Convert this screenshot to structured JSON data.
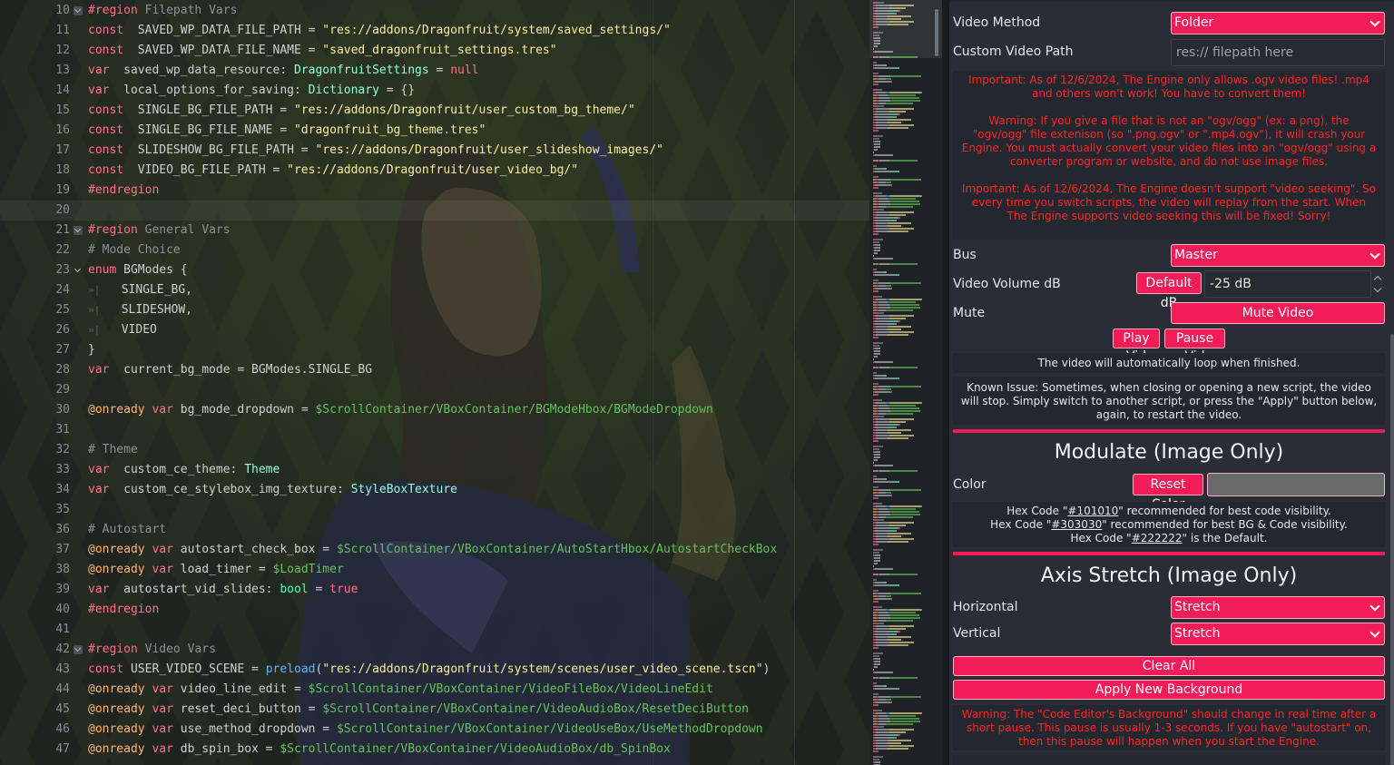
{
  "editor": {
    "lines": [
      {
        "n": "10",
        "fold": "closed",
        "spans": [
          [
            "kw",
            "#region"
          ],
          [
            "cm",
            " Filepath Vars"
          ]
        ]
      },
      {
        "n": "11",
        "spans": [
          [
            "kw",
            "const"
          ],
          [
            "",
            "  SAVED_WP_DATA_FILE_PATH = "
          ],
          [
            "str",
            "\"res://addons/Dragonfruit/system/saved_settings/\""
          ]
        ]
      },
      {
        "n": "12",
        "spans": [
          [
            "kw",
            "const"
          ],
          [
            "",
            "  SAVED_WP_DATA_FILE_NAME = "
          ],
          [
            "str",
            "\"saved_dragonfruit_settings.tres\""
          ]
        ]
      },
      {
        "n": "13",
        "spans": [
          [
            "kw",
            "var"
          ],
          [
            "",
            "  saved_wp_data_resource: "
          ],
          [
            "ty",
            "DragonfruitSettings"
          ],
          [
            "",
            " = "
          ],
          [
            "kw",
            "null"
          ]
        ]
      },
      {
        "n": "14",
        "spans": [
          [
            "kw",
            "var"
          ],
          [
            "",
            "  local_options_for_saving: "
          ],
          [
            "ty",
            "Dictionary"
          ],
          [
            "",
            " = {}"
          ]
        ]
      },
      {
        "n": "15",
        "spans": [
          [
            "kw",
            "const"
          ],
          [
            "",
            "  SINGLE_BG_FILE_PATH = "
          ],
          [
            "str",
            "\"res://addons/Dragonfruit/user_custom_bg_theme/\""
          ]
        ]
      },
      {
        "n": "16",
        "spans": [
          [
            "kw",
            "const"
          ],
          [
            "",
            "  SINGLE_BG_FILE_NAME = "
          ],
          [
            "str",
            "\"dragonfruit_bg_theme.tres\""
          ]
        ]
      },
      {
        "n": "17",
        "spans": [
          [
            "kw",
            "const"
          ],
          [
            "",
            "  SLIDESHOW_BG_FILE_PATH = "
          ],
          [
            "str",
            "\"res://addons/Dragonfruit/user_slideshow_images/\""
          ]
        ]
      },
      {
        "n": "18",
        "spans": [
          [
            "kw",
            "const"
          ],
          [
            "",
            "  VIDEO_BG_FILE_PATH = "
          ],
          [
            "str",
            "\"res://addons/Dragonfruit/user_video_bg/\""
          ]
        ]
      },
      {
        "n": "19",
        "spans": [
          [
            "kw",
            "#endregion"
          ]
        ]
      },
      {
        "n": "20",
        "hl": true,
        "spans": []
      },
      {
        "n": "21",
        "fold": "closed",
        "spans": [
          [
            "kw",
            "#region"
          ],
          [
            "cm",
            " General Vars"
          ]
        ]
      },
      {
        "n": "22",
        "spans": [
          [
            "cm",
            "# Mode Choice"
          ]
        ]
      },
      {
        "n": "23",
        "fold": "open",
        "spans": [
          [
            "kw",
            "enum"
          ],
          [
            "",
            " BGModes {"
          ]
        ]
      },
      {
        "n": "24",
        "spans": [
          [
            "tab",
            "»|"
          ],
          [
            "",
            "   SINGLE_BG,"
          ]
        ]
      },
      {
        "n": "25",
        "spans": [
          [
            "tab",
            "»|"
          ],
          [
            "",
            "   SLIDESHOW,"
          ]
        ]
      },
      {
        "n": "26",
        "spans": [
          [
            "tab",
            "»|"
          ],
          [
            "",
            "   VIDEO"
          ]
        ]
      },
      {
        "n": "27",
        "spans": [
          [
            "",
            "}"
          ]
        ]
      },
      {
        "n": "28",
        "spans": [
          [
            "kw",
            "var"
          ],
          [
            "",
            "  current_bg_mode = BGModes.SINGLE_BG"
          ]
        ]
      },
      {
        "n": "29",
        "spans": []
      },
      {
        "n": "30",
        "spans": [
          [
            "an",
            "@onready"
          ],
          [
            "",
            ""
          ],
          [
            "kw",
            " var"
          ],
          [
            "",
            " bg_mode_dropdown = "
          ],
          [
            "nd",
            "$ScrollContainer/VBoxContainer/BGModeHbox/BGModeDropdown"
          ]
        ]
      },
      {
        "n": "31",
        "spans": []
      },
      {
        "n": "32",
        "spans": [
          [
            "cm",
            "# Theme"
          ]
        ]
      },
      {
        "n": "33",
        "spans": [
          [
            "kw",
            "var"
          ],
          [
            "",
            "  custom_ce_theme: "
          ],
          [
            "ty",
            "Theme"
          ]
        ]
      },
      {
        "n": "34",
        "spans": [
          [
            "kw",
            "var"
          ],
          [
            "",
            "  custom_ce_stylebox_img_texture: "
          ],
          [
            "ty",
            "StyleBoxTexture"
          ]
        ]
      },
      {
        "n": "35",
        "spans": []
      },
      {
        "n": "36",
        "spans": [
          [
            "cm",
            "# Autostart"
          ]
        ]
      },
      {
        "n": "37",
        "spans": [
          [
            "an",
            "@onready"
          ],
          [
            "kw",
            " var"
          ],
          [
            "",
            " autostart_check_box = "
          ],
          [
            "nd",
            "$ScrollContainer/VBoxContainer/AutoStartHbox/AutostartCheckBox"
          ]
        ]
      },
      {
        "n": "38",
        "spans": [
          [
            "an",
            "@onready"
          ],
          [
            "kw",
            " var"
          ],
          [
            "",
            " load_timer = "
          ],
          [
            "nd",
            "$LoadTimer"
          ]
        ]
      },
      {
        "n": "39",
        "spans": [
          [
            "kw",
            "var"
          ],
          [
            "",
            "  autostart_vid_slides: "
          ],
          [
            "bi",
            "bool"
          ],
          [
            "",
            " = "
          ],
          [
            "kw",
            "true"
          ]
        ]
      },
      {
        "n": "40",
        "spans": [
          [
            "kw",
            "#endregion"
          ]
        ]
      },
      {
        "n": "41",
        "spans": []
      },
      {
        "n": "42",
        "fold": "closed",
        "spans": [
          [
            "kw",
            "#region"
          ],
          [
            "cm",
            " Video Vars"
          ]
        ]
      },
      {
        "n": "43",
        "spans": [
          [
            "kw",
            "const"
          ],
          [
            "",
            " USER_VIDEO_SCENE = "
          ],
          [
            "fn",
            "preload"
          ],
          [
            "",
            "("
          ],
          [
            "str",
            "\"res://addons/Dragonfruit/system/scenes/user_video_scene.tscn\""
          ],
          [
            "",
            ")"
          ]
        ]
      },
      {
        "n": "44",
        "spans": [
          [
            "an",
            "@onready"
          ],
          [
            "kw",
            " var"
          ],
          [
            "",
            " video_line_edit = "
          ],
          [
            "nd",
            "$ScrollContainer/VBoxContainer/VideoFileBox/VideoLineEdit"
          ]
        ]
      },
      {
        "n": "45",
        "spans": [
          [
            "an",
            "@onready"
          ],
          [
            "kw",
            " var"
          ],
          [
            "",
            " reset_deci_button = "
          ],
          [
            "nd",
            "$ScrollContainer/VBoxContainer/VideoAudioBox/ResetDeciButton"
          ]
        ]
      },
      {
        "n": "46",
        "spans": [
          [
            "an",
            "@onready"
          ],
          [
            "kw",
            " var"
          ],
          [
            "",
            " use_method_dropdown = "
          ],
          [
            "nd",
            "$ScrollContainer/VBoxContainer/VideoUseBox/UseMethodDropdown"
          ]
        ]
      },
      {
        "n": "47",
        "spans": [
          [
            "an",
            "@onready"
          ],
          [
            "kw",
            " var"
          ],
          [
            "",
            " db_spin_box = "
          ],
          [
            "nd",
            "$ScrollContainer/VBoxContainer/VideoAudioBox/db_SpinBox"
          ]
        ]
      }
    ]
  },
  "panel": {
    "video_method_label": "Video Method",
    "video_method_value": "Folder",
    "custom_video_path_label": "Custom Video Path",
    "custom_video_path_placeholder": "res:// filepath here",
    "important_1": "Important: As of 12/6/2024, The Engine only allows .ogv video files! .mp4 and others won't work! You have to convert them!",
    "warning_1": "Warning: If you give a file that is not an \"ogv/ogg\" (ex: a png), the \"ogv/ogg\" file extenison (so \".png.ogv\" or \".mp4.ogv\"), it will crash your Engine. You must actually convert your video files into an \"ogv/ogg\" using a converter program or website, and do not use image files.",
    "important_2": "Important: As of 12/6/2024, The Engine doesn't support \"video seeking\". So every time you switch scripts, the video will replay from the start. When The Engine supports video seeking this will be fixed! Sorry!",
    "bus_label": "Bus",
    "bus_value": "Master",
    "volume_label": "Video Volume dB",
    "default_db_button": "Default dB",
    "volume_value": "-25 dB",
    "mute_label": "Mute",
    "mute_button": "Mute Video",
    "play_button": "Play Vid",
    "pause_button": "Pause Vid",
    "loop_note": "The video will automatically loop when finished.",
    "known_issue": "Known Issue: Sometimes, when closing or opening a new script, the video will stop. Simply switch to another script, or press the \"Apply\" button below, again, to restart the video.",
    "modulate_title": "Modulate (Image Only)",
    "color_label": "Color",
    "reset_color_button": "Reset Color",
    "color_swatch": "#6a6a6a",
    "hex_line1_pre": "Hex Code \"",
    "hex_line1_code": "#101010",
    "hex_line1_post": "\" recommended for best code visibility.",
    "hex_line2_pre": "Hex Code \"",
    "hex_line2_code": "#303030",
    "hex_line2_post": "\" recommended for best BG & Code visibility.",
    "hex_line3_pre": "Hex Code \"",
    "hex_line3_code": "#222222",
    "hex_line3_post": "\" is the Default.",
    "axis_title": "Axis Stretch (Image Only)",
    "horizontal_label": "Horizontal",
    "horizontal_value": "Stretch",
    "vertical_label": "Vertical",
    "vertical_value": "Stretch",
    "clear_all_button": "Clear All",
    "apply_button": "Apply New Background",
    "warning_2": "Warning: The \"Code Editor's Background\" should change in real time after a short pause. This pause is usually 1-3 seconds. If you have \"autostart\" on, then this pause will happen when you start the Engine."
  },
  "colors": {
    "accent": "#f21d58",
    "warning_text": "#ff2424",
    "panel_bg": "#2a2d35",
    "editor_bg": "#22262a"
  }
}
